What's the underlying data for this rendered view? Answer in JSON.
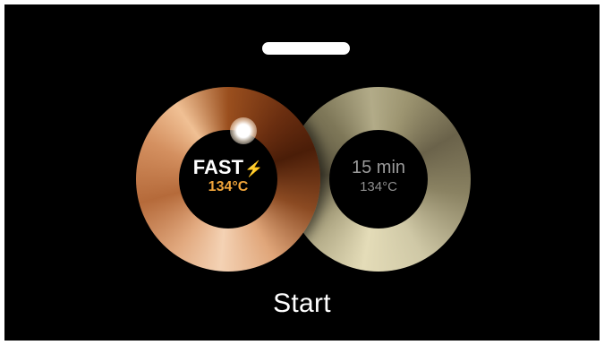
{
  "programs": [
    {
      "mode": "FAST",
      "mode_icon": "lightning-bolt-icon",
      "mode_icon_glyph": "⚡",
      "temperature": "134°C",
      "selected": true,
      "accent_color": "#f0a43a",
      "ring_color": "copper"
    },
    {
      "mode": "15 min",
      "temperature": "134°C",
      "selected": false,
      "ring_color": "gold"
    }
  ],
  "start_label": "Start"
}
